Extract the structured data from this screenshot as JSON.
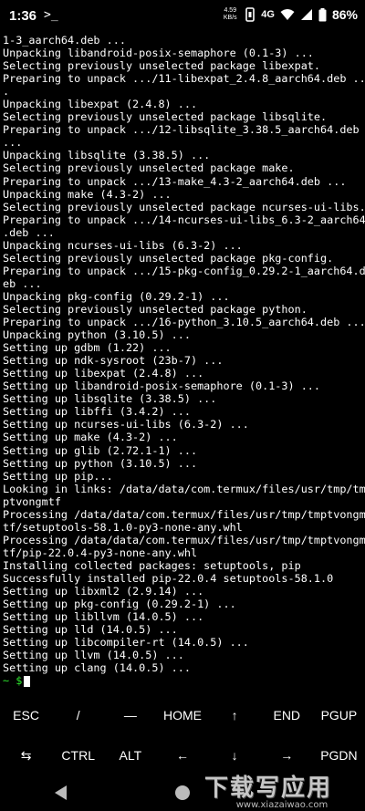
{
  "status_bar": {
    "time": "1:36",
    "app_glyph": ">_",
    "net_speed": "4.59",
    "net_speed_unit": "KB/s",
    "network": "4G",
    "battery_percent": "86%"
  },
  "terminal": {
    "lines": [
      "1-3_aarch64.deb ...",
      "Unpacking libandroid-posix-semaphore (0.1-3) ...",
      "Selecting previously unselected package libexpat.",
      "Preparing to unpack .../11-libexpat_2.4.8_aarch64.deb ..",
      ".",
      "Unpacking libexpat (2.4.8) ...",
      "Selecting previously unselected package libsqlite.",
      "Preparing to unpack .../12-libsqlite_3.38.5_aarch64.deb",
      "...",
      "Unpacking libsqlite (3.38.5) ...",
      "Selecting previously unselected package make.",
      "Preparing to unpack .../13-make_4.3-2_aarch64.deb ...",
      "Unpacking make (4.3-2) ...",
      "Selecting previously unselected package ncurses-ui-libs.",
      "Preparing to unpack .../14-ncurses-ui-libs_6.3-2_aarch64",
      ".deb ...",
      "Unpacking ncurses-ui-libs (6.3-2) ...",
      "Selecting previously unselected package pkg-config.",
      "Preparing to unpack .../15-pkg-config_0.29.2-1_aarch64.d",
      "eb ...",
      "Unpacking pkg-config (0.29.2-1) ...",
      "Selecting previously unselected package python.",
      "Preparing to unpack .../16-python_3.10.5_aarch64.deb ...",
      "Unpacking python (3.10.5) ...",
      "Setting up gdbm (1.22) ...",
      "Setting up ndk-sysroot (23b-7) ...",
      "Setting up libexpat (2.4.8) ...",
      "Setting up libandroid-posix-semaphore (0.1-3) ...",
      "Setting up libsqlite (3.38.5) ...",
      "Setting up libffi (3.4.2) ...",
      "Setting up ncurses-ui-libs (6.3-2) ...",
      "Setting up make (4.3-2) ...",
      "Setting up glib (2.72.1-1) ...",
      "Setting up python (3.10.5) ...",
      "Setting up pip...",
      "Looking in links: /data/data/com.termux/files/usr/tmp/tm",
      "ptvongmtf",
      "Processing /data/data/com.termux/files/usr/tmp/tmptvongm",
      "tf/setuptools-58.1.0-py3-none-any.whl",
      "Processing /data/data/com.termux/files/usr/tmp/tmptvongm",
      "tf/pip-22.0.4-py3-none-any.whl",
      "Installing collected packages: setuptools, pip",
      "Successfully installed pip-22.0.4 setuptools-58.1.0",
      "Setting up libxml2 (2.9.14) ...",
      "Setting up pkg-config (0.29.2-1) ...",
      "Setting up libllvm (14.0.5) ...",
      "Setting up lld (14.0.5) ...",
      "Setting up libcompiler-rt (14.0.5) ...",
      "Setting up llvm (14.0.5) ...",
      "Setting up clang (14.0.5) ..."
    ],
    "prompt": "~ $"
  },
  "extra_keys": {
    "row1": [
      "ESC",
      "/",
      "—",
      "HOME",
      "↑",
      "END",
      "PGUP"
    ],
    "row2": [
      "⇆",
      "CTRL",
      "ALT",
      "←",
      "↓",
      "→",
      "PGDN"
    ]
  },
  "watermark": {
    "title": "下载写应用",
    "url": "www.xiazaiwao.com"
  }
}
